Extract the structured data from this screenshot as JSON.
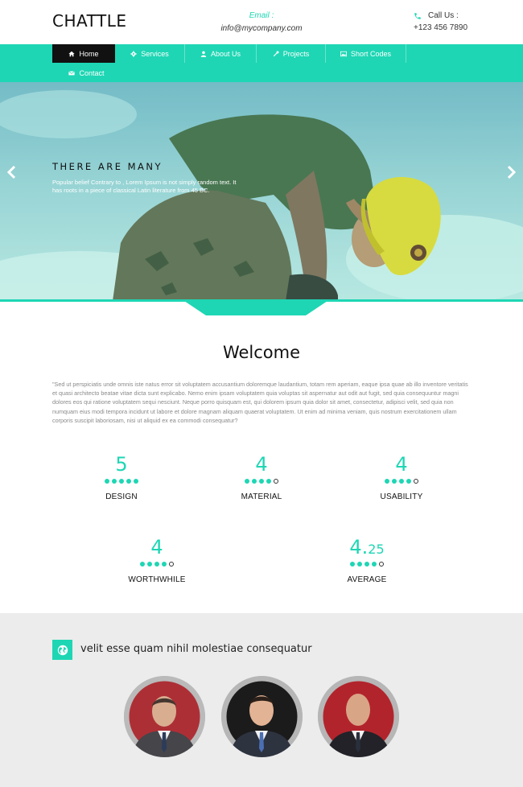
{
  "header": {
    "logo": "CHATTLE",
    "email_label": "Email :",
    "email_value": "info@mycompany.com",
    "call_label": "Call Us :",
    "phone": "+123 456 7890"
  },
  "nav": {
    "items": [
      {
        "label": "Home",
        "icon": "home-icon",
        "active": true
      },
      {
        "label": "Services",
        "icon": "gear-icon"
      },
      {
        "label": "About Us",
        "icon": "user-icon"
      },
      {
        "label": "Projects",
        "icon": "tools-icon"
      },
      {
        "label": "Short Codes",
        "icon": "image-icon"
      },
      {
        "label": "Contact",
        "icon": "envelope-icon"
      }
    ]
  },
  "hero": {
    "title": "THERE ARE MANY",
    "text": "Popular belief Contrary to , Lorem Ipsum is not simply random text. It has roots in a piece of classical Latin literature from 45 BC."
  },
  "welcome": {
    "title": "Welcome",
    "text": "\"Sed ut perspiciatis unde omnis iste natus error sit voluptatem accusantium doloremque laudantium, totam rem aperiam, eaque ipsa quae ab illo inventore veritatis et quasi architecto beatae vitae dicta sunt explicabo. Nemo enim ipsam voluptatem quia voluptas sit aspernatur aut odit aut fugit, sed quia consequuntur magni dolores eos qui ratione voluptatem sequi nesciunt. Neque porro quisquam est, qui dolorem ipsum quia dolor sit amet, consectetur, adipisci velit, sed quia non numquam eius modi tempora incidunt ut labore et dolore magnam aliquam quaerat voluptatem. Ut enim ad minima veniam, quis nostrum exercitationem ullam corporis suscipit laboriosam, nisi ut aliquid ex ea commodi consequatur?"
  },
  "ratings": [
    {
      "value": "5",
      "label": "DESIGN",
      "filled": 5,
      "total": 5
    },
    {
      "value": "4",
      "label": "MATERIAL",
      "filled": 4,
      "total": 5
    },
    {
      "value": "4",
      "label": "USABILITY",
      "filled": 4,
      "total": 5
    },
    {
      "value": "4",
      "label": "WORTHWHILE",
      "filled": 4,
      "total": 5
    },
    {
      "value_main": "4.",
      "value_sub": "25",
      "label": "AVERAGE",
      "filled": 4,
      "total": 5
    }
  ],
  "team": {
    "heading": "velit esse quam nihil molestiae consequatur",
    "icon": "globe-icon"
  },
  "colors": {
    "accent": "#1ed6b4",
    "nav_active": "#111111",
    "team_bg": "#ececec"
  }
}
